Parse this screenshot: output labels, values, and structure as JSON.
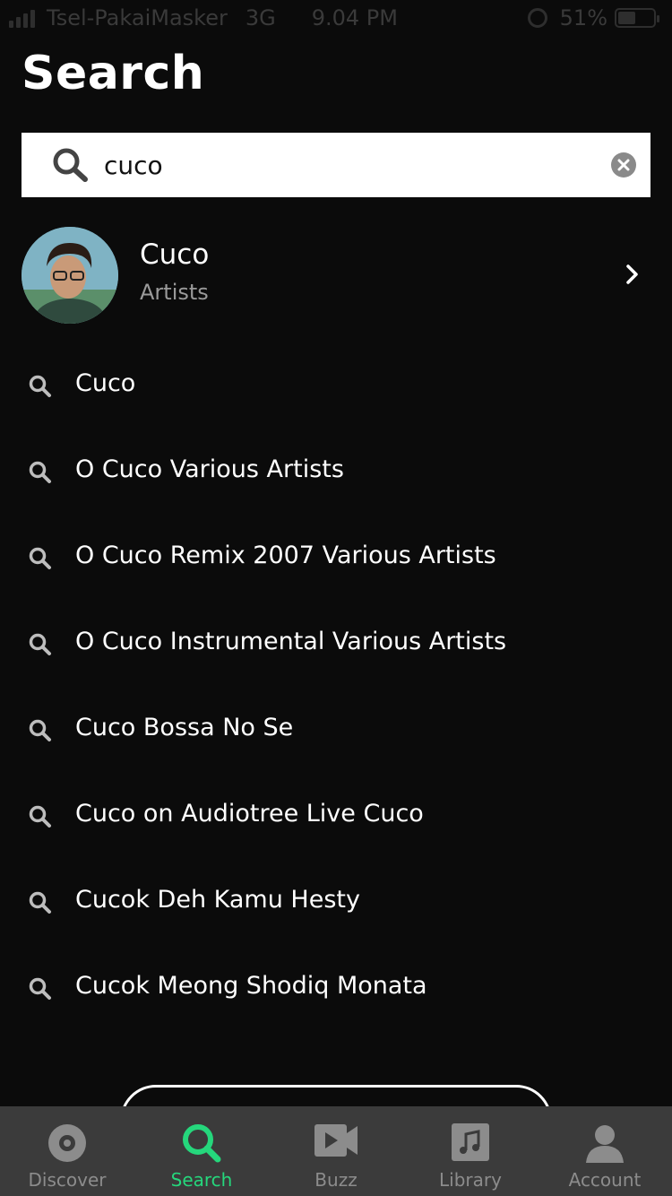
{
  "status_bar": {
    "carrier": "Tsel-PakaiMasker",
    "network": "3G",
    "time": "9.04 PM",
    "battery": "51%",
    "battery_level": 0.51
  },
  "header": {
    "title": "Search"
  },
  "search": {
    "value": "cuco",
    "placeholder": ""
  },
  "artist_result": {
    "name": "Cuco",
    "type": "Artists"
  },
  "suggestions": [
    "Cuco",
    "O Cuco Various Artists",
    "O Cuco Remix 2007 Various Artists",
    "O Cuco Instrumental Various Artists",
    "Cuco Bossa No Se",
    "Cuco on Audiotree Live Cuco",
    "Cucok Deh Kamu Hesty",
    "Cucok Meong Shodiq Monata"
  ],
  "tabs": [
    {
      "label": "Discover",
      "icon": "disc-icon",
      "active": false
    },
    {
      "label": "Search",
      "icon": "search-icon",
      "active": true
    },
    {
      "label": "Buzz",
      "icon": "video-icon",
      "active": false
    },
    {
      "label": "Library",
      "icon": "music-note-icon",
      "active": false
    },
    {
      "label": "Account",
      "icon": "person-icon",
      "active": false
    }
  ],
  "colors": {
    "accent": "#25d77c",
    "background": "#0b0b0b",
    "tabbar": "#3b3b3b",
    "inactive": "#8c8c8c"
  }
}
